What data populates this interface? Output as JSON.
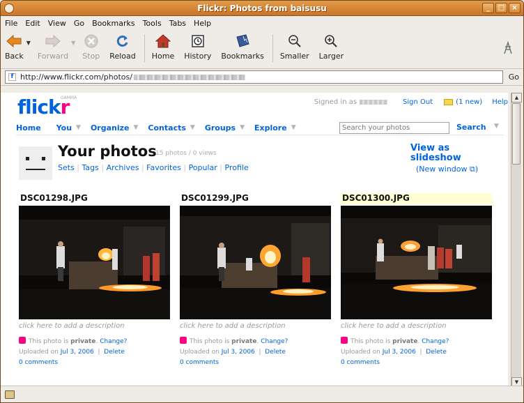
{
  "window": {
    "title": "Flickr: Photos from baisusu"
  },
  "menu": [
    "File",
    "Edit",
    "View",
    "Go",
    "Bookmarks",
    "Tools",
    "Tabs",
    "Help"
  ],
  "toolbar": {
    "back": "Back",
    "forward": "Forward",
    "stop": "Stop",
    "reload": "Reload",
    "home": "Home",
    "history": "History",
    "bookmarks": "Bookmarks",
    "smaller": "Smaller",
    "larger": "Larger"
  },
  "urlbar": {
    "url": "http://www.flickr.com/photos/",
    "go": "Go"
  },
  "flickr": {
    "logo_blue": "flick",
    "logo_pink": "r",
    "gamma": "GAMMA",
    "signed_in": "Signed in as",
    "sign_out": "Sign Out",
    "mail": "(1 new)",
    "help": "Help",
    "nav": [
      "Home",
      "You",
      "Organize",
      "Contacts",
      "Groups",
      "Explore"
    ],
    "search_placeholder": "Search your photos",
    "search_btn": "Search",
    "page_title": "Your photos",
    "stats": "15 photos / 0 views",
    "subnav": [
      "Sets",
      "Tags",
      "Archives",
      "Favorites",
      "Popular",
      "Profile"
    ],
    "slideshow": "View as slideshow",
    "new_window": "(New window ⧉)"
  },
  "photos": [
    {
      "title": "DSC01298.JPG",
      "desc": "click here to add a description",
      "privacy_pre": "This photo is",
      "privacy": "private",
      "change": "Change?",
      "uploaded_pre": "Uploaded on",
      "date": "Jul 3, 2006",
      "delete": "Delete",
      "comments": "0 comments"
    },
    {
      "title": "DSC01299.JPG",
      "desc": "click here to add a description",
      "privacy_pre": "This photo is",
      "privacy": "private",
      "change": "Change?",
      "uploaded_pre": "Uploaded on",
      "date": "Jul 3, 2006",
      "delete": "Delete",
      "comments": "0 comments"
    },
    {
      "title": "DSC01300.JPG",
      "desc": "click here to add a description",
      "privacy_pre": "This photo is",
      "privacy": "private",
      "change": "Change?",
      "uploaded_pre": "Uploaded on",
      "date": "Jul 3, 2006",
      "delete": "Delete",
      "comments": "0 comments"
    }
  ]
}
